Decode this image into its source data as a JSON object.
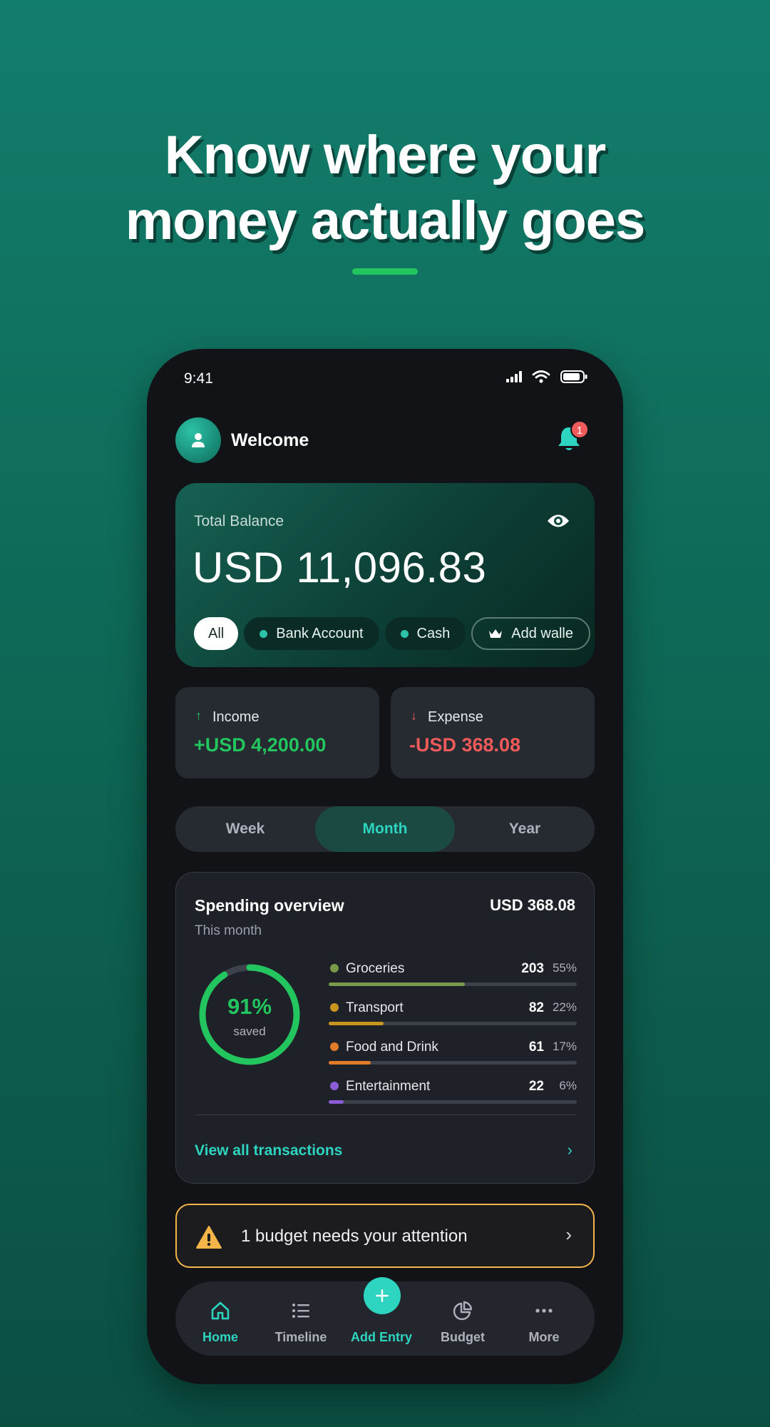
{
  "headline": {
    "line1": "Know where your",
    "line2": "money actually goes"
  },
  "status_bar": {
    "time": "9:41"
  },
  "header": {
    "welcome": "Welcome",
    "notification_count": "1"
  },
  "balance": {
    "label": "Total Balance",
    "amount": "USD 11,096.83",
    "wallets": [
      {
        "label": "All"
      },
      {
        "label": "Bank Account"
      },
      {
        "label": "Cash"
      },
      {
        "label": "Add walle"
      }
    ]
  },
  "stats": {
    "income": {
      "label": "Income",
      "value": "+USD 4,200.00",
      "color": "#22c55e"
    },
    "expense": {
      "label": "Expense",
      "value": "-USD 368.08",
      "color": "#ef5b5b"
    }
  },
  "period_tabs": [
    {
      "label": "Week",
      "active": false
    },
    {
      "label": "Month",
      "active": true
    },
    {
      "label": "Year",
      "active": false
    }
  ],
  "overview": {
    "title": "Spending overview",
    "total": "USD 368.08",
    "subtitle": "This month",
    "saved_percent": "91%",
    "saved_fraction": 0.91,
    "saved_label": "saved",
    "categories": [
      {
        "name": "Groceries",
        "amount": "203",
        "percent": "55%",
        "fraction": 0.55,
        "color": "#7a9a4a"
      },
      {
        "name": "Transport",
        "amount": "82",
        "percent": "22%",
        "fraction": 0.22,
        "color": "#c8961e"
      },
      {
        "name": "Food and Drink",
        "amount": "61",
        "percent": "17%",
        "fraction": 0.17,
        "color": "#e07b2a"
      },
      {
        "name": "Entertainment",
        "amount": "22",
        "percent": "6%",
        "fraction": 0.06,
        "color": "#8b5cd6"
      }
    ],
    "link": "View all transactions"
  },
  "alert": {
    "text": "1 budget needs your attention"
  },
  "nav": [
    {
      "label": "Home",
      "icon": "home-icon",
      "active": true
    },
    {
      "label": "Timeline",
      "icon": "list-icon",
      "active": false
    },
    {
      "label": "Add Entry",
      "icon": "plus-icon",
      "active": true
    },
    {
      "label": "Budget",
      "icon": "pie-chart-icon",
      "active": false
    },
    {
      "label": "More",
      "icon": "more-icon",
      "active": false
    }
  ],
  "colors": {
    "accent": "#2dd4bf",
    "income": "#22c55e",
    "expense": "#ef5b5b",
    "warning": "#f5b447"
  }
}
